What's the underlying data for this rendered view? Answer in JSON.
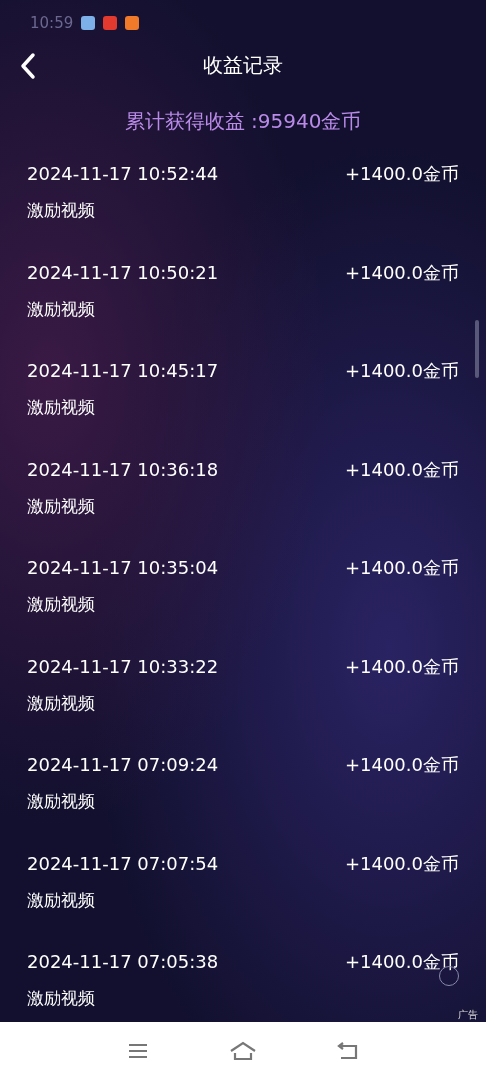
{
  "status_bar": {
    "time": "10:59"
  },
  "header": {
    "title": "收益记录"
  },
  "total": "累计获得收益 :95940金币",
  "records": [
    {
      "time": "2024-11-17 10:52:44",
      "amount": "+1400.0金币",
      "type": "激励视频"
    },
    {
      "time": "2024-11-17 10:50:21",
      "amount": "+1400.0金币",
      "type": "激励视频"
    },
    {
      "time": "2024-11-17 10:45:17",
      "amount": "+1400.0金币",
      "type": "激励视频"
    },
    {
      "time": "2024-11-17 10:36:18",
      "amount": "+1400.0金币",
      "type": "激励视频"
    },
    {
      "time": "2024-11-17 10:35:04",
      "amount": "+1400.0金币",
      "type": "激励视频"
    },
    {
      "time": "2024-11-17 10:33:22",
      "amount": "+1400.0金币",
      "type": "激励视频"
    },
    {
      "time": "2024-11-17 07:09:24",
      "amount": "+1400.0金币",
      "type": "激励视频"
    },
    {
      "time": "2024-11-17 07:07:54",
      "amount": "+1400.0金币",
      "type": "激励视频"
    },
    {
      "time": "2024-11-17 07:05:38",
      "amount": "+1400.0金币",
      "type": "激励视频"
    }
  ],
  "ad_label": "广告"
}
